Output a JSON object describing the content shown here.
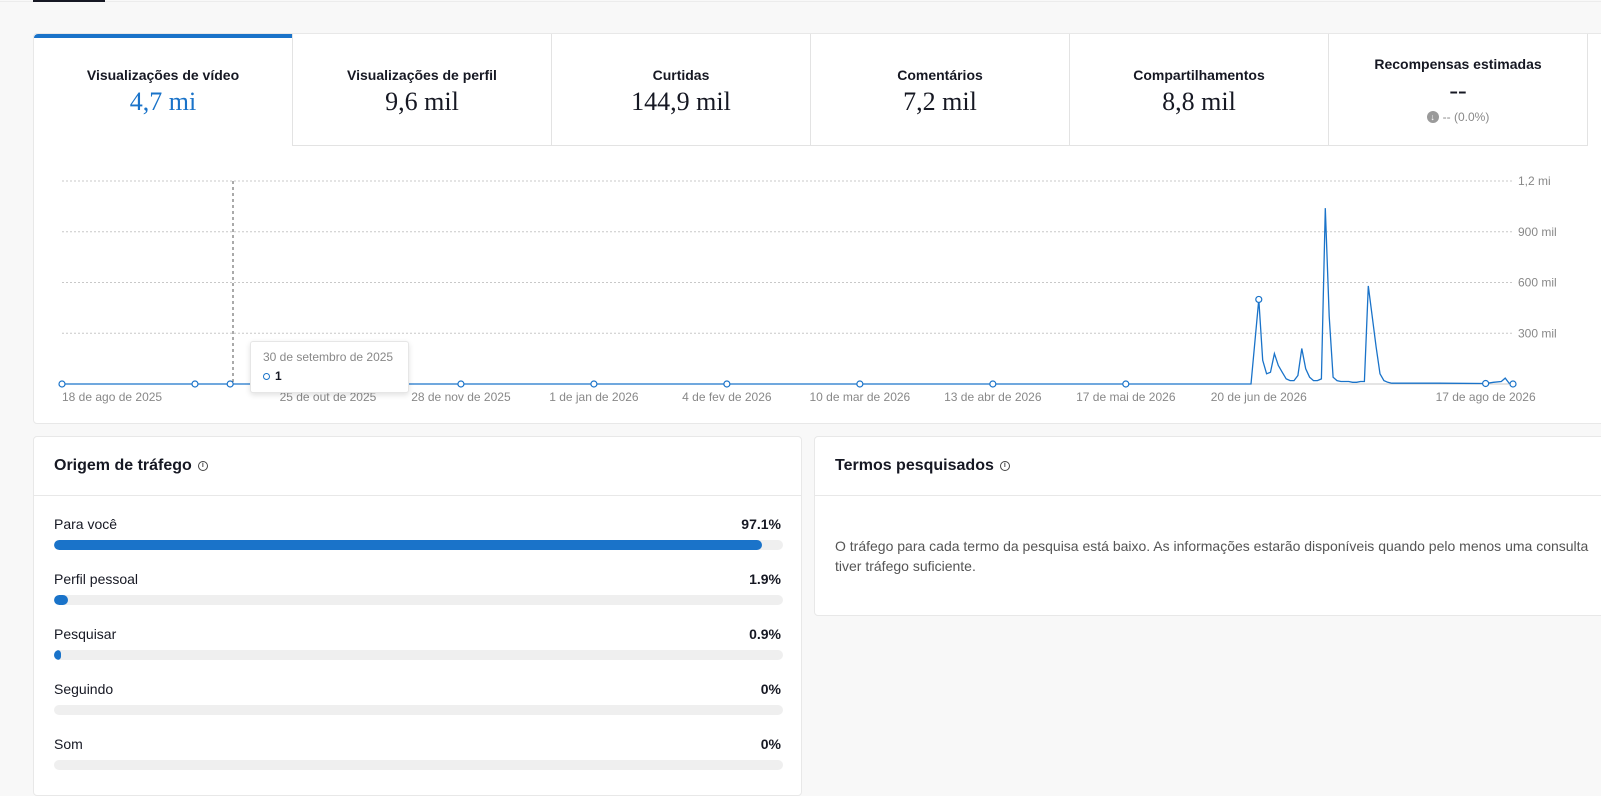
{
  "tabs": [
    {
      "label": "Visualizações de vídeo",
      "value": "4,7 mi"
    },
    {
      "label": "Visualizações de perfil",
      "value": "9,6 mil"
    },
    {
      "label": "Curtidas",
      "value": "144,9 mil"
    },
    {
      "label": "Comentários",
      "value": "7,2 mil"
    },
    {
      "label": "Compartilhamentos",
      "value": "8,8 mil"
    },
    {
      "label": "Recompensas estimadas",
      "value": "--",
      "sub": "-- (0.0%)"
    }
  ],
  "chart_data": {
    "type": "line",
    "y_ticks": [
      "1,2 mi",
      "900 mil",
      "600 mil",
      "300 mil"
    ],
    "y_tick_values": [
      1200000,
      900000,
      600000,
      300000
    ],
    "ylim": [
      0,
      1200000
    ],
    "x_ticks": [
      "18 de ago de 2025",
      "25 de out de 2025",
      "28 de nov de 2025",
      "1 de jan de 2026",
      "4 de fev de 2026",
      "10 de mar de 2026",
      "13 de abr de 2026",
      "17 de mai de 2026",
      "20 de jun de 2026",
      "17 de ago de 2026"
    ],
    "x_tick_dates": [
      "2025-08-18",
      "2025-10-25",
      "2025-11-28",
      "2026-01-01",
      "2026-02-04",
      "2026-03-10",
      "2026-04-13",
      "2026-05-17",
      "2026-06-20",
      "2026-08-17"
    ],
    "xlim": [
      "2025-08-18",
      "2026-08-24"
    ],
    "grid": true,
    "series": [
      {
        "color": "#1a73c9",
        "points": [
          [
            "2025-08-18",
            0
          ],
          [
            "2025-09-21",
            0
          ],
          [
            "2025-09-30",
            1
          ],
          [
            "2025-10-25",
            0
          ],
          [
            "2025-11-28",
            0
          ],
          [
            "2026-01-01",
            0
          ],
          [
            "2026-02-04",
            0
          ],
          [
            "2026-03-10",
            0
          ],
          [
            "2026-04-13",
            0
          ],
          [
            "2026-05-17",
            0
          ],
          [
            "2026-06-18",
            0
          ],
          [
            "2026-06-20",
            500000
          ],
          [
            "2026-06-21",
            140000
          ],
          [
            "2026-06-22",
            60000
          ],
          [
            "2026-06-23",
            70000
          ],
          [
            "2026-06-24",
            180000
          ],
          [
            "2026-06-25",
            110000
          ],
          [
            "2026-06-26",
            70000
          ],
          [
            "2026-06-27",
            30000
          ],
          [
            "2026-06-28",
            20000
          ],
          [
            "2026-06-29",
            20000
          ],
          [
            "2026-06-30",
            50000
          ],
          [
            "2026-07-01",
            210000
          ],
          [
            "2026-07-02",
            90000
          ],
          [
            "2026-07-03",
            40000
          ],
          [
            "2026-07-04",
            20000
          ],
          [
            "2026-07-05",
            20000
          ],
          [
            "2026-07-06",
            30000
          ],
          [
            "2026-07-07",
            1040000
          ],
          [
            "2026-07-08",
            400000
          ],
          [
            "2026-07-09",
            40000
          ],
          [
            "2026-07-10",
            20000
          ],
          [
            "2026-07-11",
            15000
          ],
          [
            "2026-07-12",
            15000
          ],
          [
            "2026-07-13",
            15000
          ],
          [
            "2026-07-14",
            10000
          ],
          [
            "2026-07-15",
            10000
          ],
          [
            "2026-07-16",
            15000
          ],
          [
            "2026-07-17",
            15000
          ],
          [
            "2026-07-18",
            580000
          ],
          [
            "2026-07-19",
            400000
          ],
          [
            "2026-07-20",
            220000
          ],
          [
            "2026-07-21",
            60000
          ],
          [
            "2026-07-22",
            20000
          ],
          [
            "2026-07-23",
            10000
          ],
          [
            "2026-07-24",
            5000
          ],
          [
            "2026-07-25",
            5000
          ],
          [
            "2026-08-05",
            5000
          ],
          [
            "2026-08-17",
            3000
          ],
          [
            "2026-08-19",
            10000
          ],
          [
            "2026-08-21",
            15000
          ],
          [
            "2026-08-22",
            35000
          ],
          [
            "2026-08-23",
            5000
          ],
          [
            "2026-08-24",
            0
          ]
        ],
        "markers": [
          [
            "2025-08-18",
            0
          ],
          [
            "2025-09-21",
            0
          ],
          [
            "2025-09-30",
            1
          ],
          [
            "2025-11-28",
            0
          ],
          [
            "2026-01-01",
            0
          ],
          [
            "2026-02-04",
            0
          ],
          [
            "2026-03-10",
            0
          ],
          [
            "2026-04-13",
            0
          ],
          [
            "2026-05-17",
            0
          ],
          [
            "2026-06-20",
            500000
          ],
          [
            "2026-08-17",
            3000
          ],
          [
            "2026-08-24",
            0
          ]
        ]
      }
    ]
  },
  "tooltip": {
    "date": "30 de setembro de 2025",
    "value": "1"
  },
  "traffic": {
    "title": "Origem de tráfego",
    "rows": [
      {
        "label": "Para você",
        "value": "97.1%",
        "fraction": 0.971
      },
      {
        "label": "Perfil pessoal",
        "value": "1.9%",
        "fraction": 0.019
      },
      {
        "label": "Pesquisar",
        "value": "0.9%",
        "fraction": 0.009
      },
      {
        "label": "Seguindo",
        "value": "0%",
        "fraction": 0
      },
      {
        "label": "Som",
        "value": "0%",
        "fraction": 0
      }
    ]
  },
  "search_terms": {
    "title": "Termos pesquisados",
    "message": "O tráfego para cada termo da pesquisa está baixo. As informações estarão disponíveis quando pelo menos uma consulta tiver tráfego suficiente."
  },
  "colors": {
    "accent": "#1a73c9",
    "grid": "#cfcfcf",
    "muted": "#888888"
  }
}
